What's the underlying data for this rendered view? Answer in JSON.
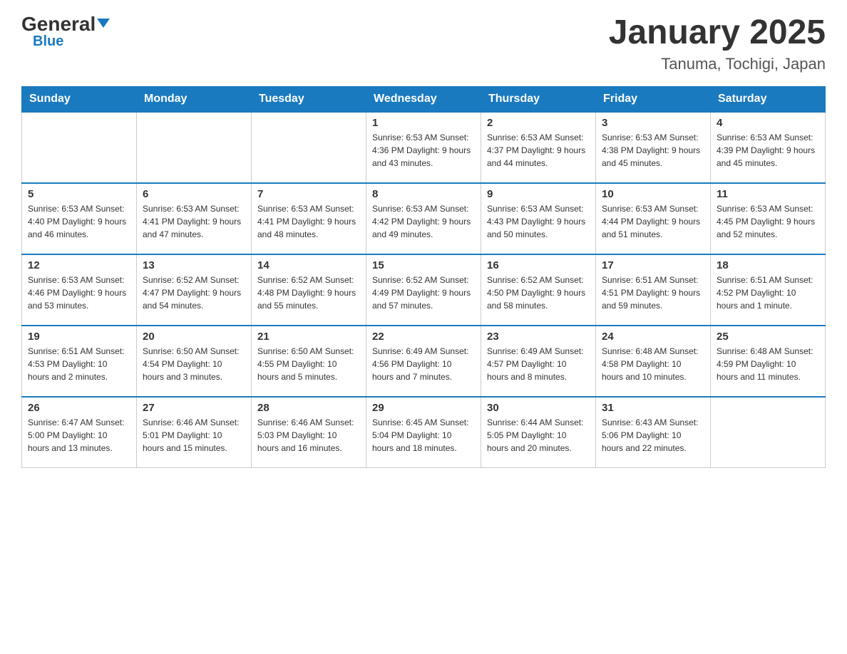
{
  "header": {
    "logo_general": "General",
    "logo_blue": "Blue",
    "month_title": "January 2025",
    "location": "Tanuma, Tochigi, Japan"
  },
  "days_of_week": [
    "Sunday",
    "Monday",
    "Tuesday",
    "Wednesday",
    "Thursday",
    "Friday",
    "Saturday"
  ],
  "weeks": [
    [
      {
        "day": "",
        "info": ""
      },
      {
        "day": "",
        "info": ""
      },
      {
        "day": "",
        "info": ""
      },
      {
        "day": "1",
        "info": "Sunrise: 6:53 AM\nSunset: 4:36 PM\nDaylight: 9 hours\nand 43 minutes."
      },
      {
        "day": "2",
        "info": "Sunrise: 6:53 AM\nSunset: 4:37 PM\nDaylight: 9 hours\nand 44 minutes."
      },
      {
        "day": "3",
        "info": "Sunrise: 6:53 AM\nSunset: 4:38 PM\nDaylight: 9 hours\nand 45 minutes."
      },
      {
        "day": "4",
        "info": "Sunrise: 6:53 AM\nSunset: 4:39 PM\nDaylight: 9 hours\nand 45 minutes."
      }
    ],
    [
      {
        "day": "5",
        "info": "Sunrise: 6:53 AM\nSunset: 4:40 PM\nDaylight: 9 hours\nand 46 minutes."
      },
      {
        "day": "6",
        "info": "Sunrise: 6:53 AM\nSunset: 4:41 PM\nDaylight: 9 hours\nand 47 minutes."
      },
      {
        "day": "7",
        "info": "Sunrise: 6:53 AM\nSunset: 4:41 PM\nDaylight: 9 hours\nand 48 minutes."
      },
      {
        "day": "8",
        "info": "Sunrise: 6:53 AM\nSunset: 4:42 PM\nDaylight: 9 hours\nand 49 minutes."
      },
      {
        "day": "9",
        "info": "Sunrise: 6:53 AM\nSunset: 4:43 PM\nDaylight: 9 hours\nand 50 minutes."
      },
      {
        "day": "10",
        "info": "Sunrise: 6:53 AM\nSunset: 4:44 PM\nDaylight: 9 hours\nand 51 minutes."
      },
      {
        "day": "11",
        "info": "Sunrise: 6:53 AM\nSunset: 4:45 PM\nDaylight: 9 hours\nand 52 minutes."
      }
    ],
    [
      {
        "day": "12",
        "info": "Sunrise: 6:53 AM\nSunset: 4:46 PM\nDaylight: 9 hours\nand 53 minutes."
      },
      {
        "day": "13",
        "info": "Sunrise: 6:52 AM\nSunset: 4:47 PM\nDaylight: 9 hours\nand 54 minutes."
      },
      {
        "day": "14",
        "info": "Sunrise: 6:52 AM\nSunset: 4:48 PM\nDaylight: 9 hours\nand 55 minutes."
      },
      {
        "day": "15",
        "info": "Sunrise: 6:52 AM\nSunset: 4:49 PM\nDaylight: 9 hours\nand 57 minutes."
      },
      {
        "day": "16",
        "info": "Sunrise: 6:52 AM\nSunset: 4:50 PM\nDaylight: 9 hours\nand 58 minutes."
      },
      {
        "day": "17",
        "info": "Sunrise: 6:51 AM\nSunset: 4:51 PM\nDaylight: 9 hours\nand 59 minutes."
      },
      {
        "day": "18",
        "info": "Sunrise: 6:51 AM\nSunset: 4:52 PM\nDaylight: 10 hours\nand 1 minute."
      }
    ],
    [
      {
        "day": "19",
        "info": "Sunrise: 6:51 AM\nSunset: 4:53 PM\nDaylight: 10 hours\nand 2 minutes."
      },
      {
        "day": "20",
        "info": "Sunrise: 6:50 AM\nSunset: 4:54 PM\nDaylight: 10 hours\nand 3 minutes."
      },
      {
        "day": "21",
        "info": "Sunrise: 6:50 AM\nSunset: 4:55 PM\nDaylight: 10 hours\nand 5 minutes."
      },
      {
        "day": "22",
        "info": "Sunrise: 6:49 AM\nSunset: 4:56 PM\nDaylight: 10 hours\nand 7 minutes."
      },
      {
        "day": "23",
        "info": "Sunrise: 6:49 AM\nSunset: 4:57 PM\nDaylight: 10 hours\nand 8 minutes."
      },
      {
        "day": "24",
        "info": "Sunrise: 6:48 AM\nSunset: 4:58 PM\nDaylight: 10 hours\nand 10 minutes."
      },
      {
        "day": "25",
        "info": "Sunrise: 6:48 AM\nSunset: 4:59 PM\nDaylight: 10 hours\nand 11 minutes."
      }
    ],
    [
      {
        "day": "26",
        "info": "Sunrise: 6:47 AM\nSunset: 5:00 PM\nDaylight: 10 hours\nand 13 minutes."
      },
      {
        "day": "27",
        "info": "Sunrise: 6:46 AM\nSunset: 5:01 PM\nDaylight: 10 hours\nand 15 minutes."
      },
      {
        "day": "28",
        "info": "Sunrise: 6:46 AM\nSunset: 5:03 PM\nDaylight: 10 hours\nand 16 minutes."
      },
      {
        "day": "29",
        "info": "Sunrise: 6:45 AM\nSunset: 5:04 PM\nDaylight: 10 hours\nand 18 minutes."
      },
      {
        "day": "30",
        "info": "Sunrise: 6:44 AM\nSunset: 5:05 PM\nDaylight: 10 hours\nand 20 minutes."
      },
      {
        "day": "31",
        "info": "Sunrise: 6:43 AM\nSunset: 5:06 PM\nDaylight: 10 hours\nand 22 minutes."
      },
      {
        "day": "",
        "info": ""
      }
    ]
  ]
}
